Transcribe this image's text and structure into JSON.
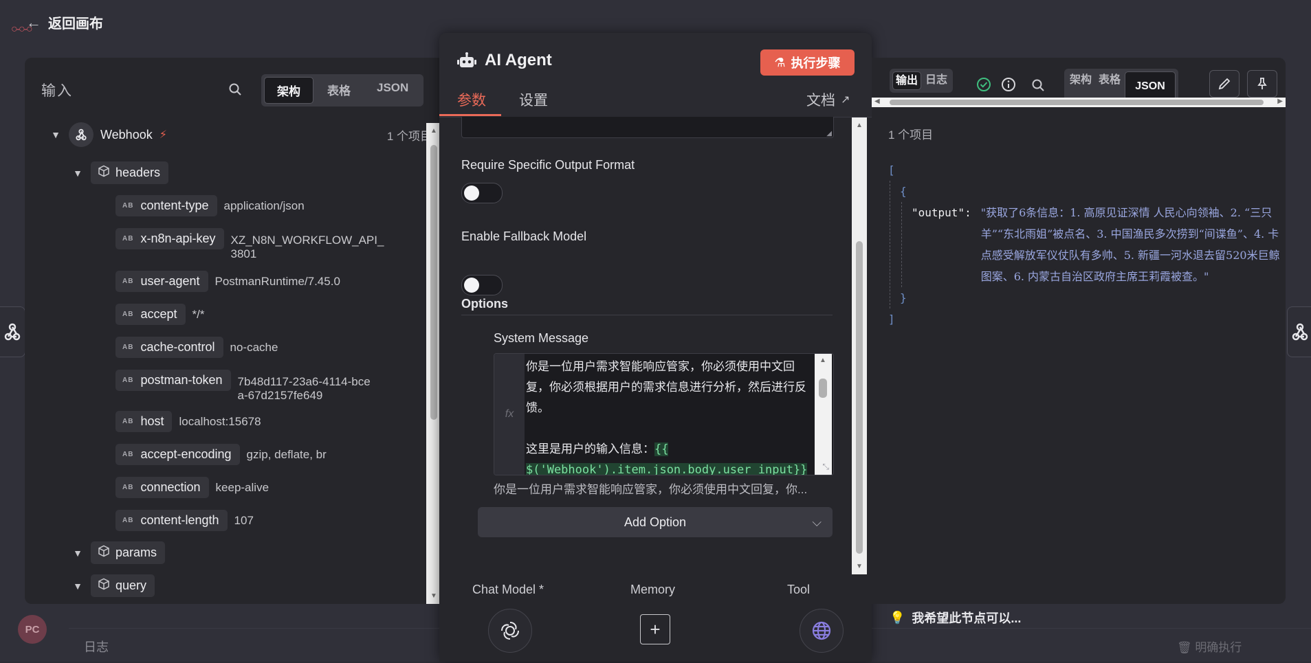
{
  "canvas": {
    "back_label": "返回画布",
    "log_label": "日志",
    "clear_execution": "明确执行",
    "avatar_initials": "PC",
    "hint_text": "我希望此节点可以..."
  },
  "input_panel": {
    "title": "输入",
    "views": [
      "架构",
      "表格",
      "JSON"
    ],
    "active_view": "架构",
    "node": {
      "name": "Webhook",
      "count": "1 个项目"
    },
    "headers_label": "headers",
    "headers": [
      {
        "key": "content-type",
        "value": "application/json"
      },
      {
        "key": "x-n8n-api-key",
        "value": "XZ_N8N_WORKFLOW_API_3801"
      },
      {
        "key": "user-agent",
        "value": "PostmanRuntime/7.45.0"
      },
      {
        "key": "accept",
        "value": "*/*"
      },
      {
        "key": "cache-control",
        "value": "no-cache"
      },
      {
        "key": "postman-token",
        "value": "7b48d117-23a6-4114-bcea-67d2157fe649"
      },
      {
        "key": "host",
        "value": "localhost:15678"
      },
      {
        "key": "accept-encoding",
        "value": "gzip, deflate, br"
      },
      {
        "key": "connection",
        "value": "keep-alive"
      },
      {
        "key": "content-length",
        "value": "107"
      }
    ],
    "params_label": "params",
    "query_label": "query"
  },
  "agent_panel": {
    "title": "AI Agent",
    "exec_button": "执行步骤",
    "tabs": [
      "参数",
      "设置"
    ],
    "active_tab": "参数",
    "docs_label": "文档",
    "require_output_label": "Require Specific Output Format",
    "require_output_on": false,
    "fallback_label": "Enable Fallback Model",
    "fallback_on": false,
    "options_label": "Options",
    "system_message_label": "System Message",
    "system_message_line1": "你是一位用户需求智能响应管家，你必须使用中文回复，你必须根据用户的需求信息进行分析，然后进行反馈。",
    "system_message_line2_prefix": "这里是用户的输入信息：",
    "system_message_expr": "{{ $('Webhook').item.json.body.user_input}}",
    "system_message_preview": "你是一位用户需求智能响应管家，你必须使用中文回复，你...",
    "add_option_label": "Add Option",
    "subnodes": [
      {
        "label": "Chat Model *",
        "icon": "openai-icon"
      },
      {
        "label": "Memory",
        "icon": "plus-icon"
      },
      {
        "label": "Tool",
        "icon": "globe-icon"
      }
    ]
  },
  "output_panel": {
    "tabs": [
      "输出",
      "日志"
    ],
    "active_tab": "输出",
    "views": [
      "架构",
      "表格",
      "JSON"
    ],
    "active_view": "JSON",
    "item_count": "1 个项目",
    "json_open_bracket": "[",
    "json_open_brace": "{",
    "json_key": "\"output\":",
    "json_value": "\"获取了6条信息：1. 高原见证深情 人民心向领袖、2. “三只羊”“东北雨姐”被点名、3. 中国渔民多次捞到“间谍鱼”、4. 卡点感受解放军仪仗队有多帅、5. 新疆一河水退去留520米巨鲸图案、6. 内蒙古自治区政府主席王莉霞被查。\"",
    "json_close_brace": "}",
    "json_close_bracket": "]"
  },
  "colors": {
    "accent": "#ea6a58",
    "exec_button": "#e6604f",
    "success": "#3fbf7f",
    "json_string": "#9aa7e0"
  }
}
